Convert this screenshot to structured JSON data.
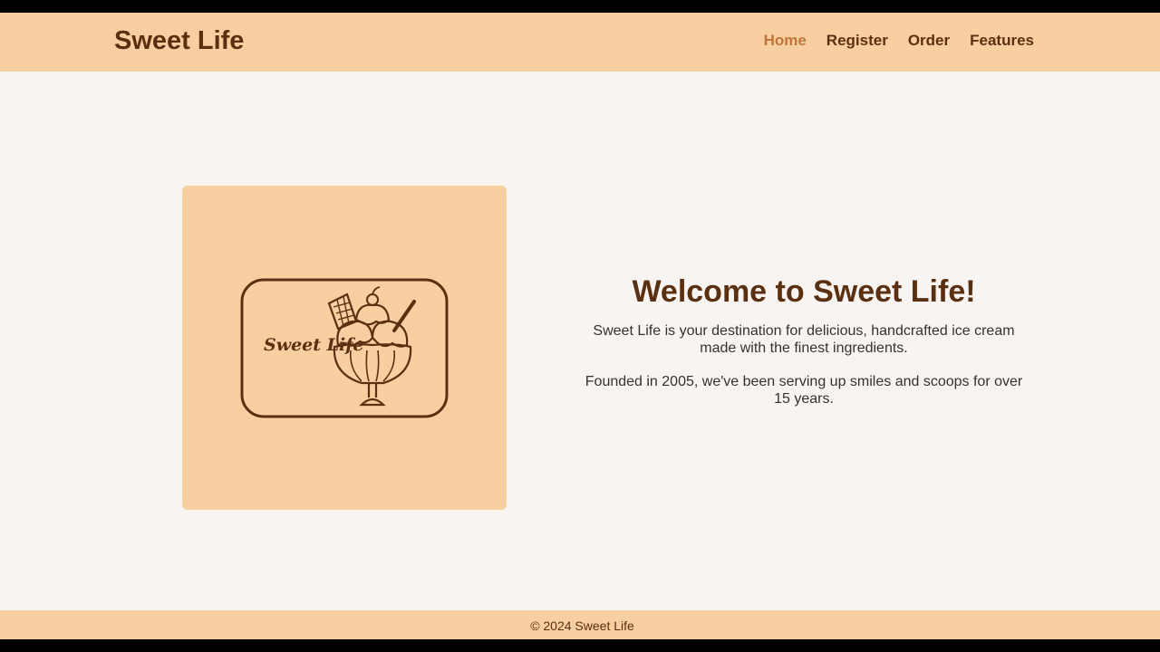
{
  "header": {
    "brand": "Sweet Life",
    "nav": [
      {
        "label": "Home",
        "active": true
      },
      {
        "label": "Register",
        "active": false
      },
      {
        "label": "Order",
        "active": false
      },
      {
        "label": "Features",
        "active": false
      }
    ]
  },
  "hero": {
    "logo_icon": "ice-cream-sundae-icon",
    "logo_text": "Sweet Life",
    "title": "Welcome to Sweet Life!",
    "paragraphs": [
      "Sweet Life is your destination for delicious, handcrafted ice cream made with the finest ingredients.",
      "Founded in 2005, we've been serving up smiles and scoops for over 15 years."
    ]
  },
  "footer": {
    "text": "© 2024 Sweet Life"
  },
  "colors": {
    "accent_bg": "#f7cfa0",
    "brand_text": "#5a3010",
    "active_nav": "#c0753a",
    "page_bg": "#f8f4f1"
  }
}
